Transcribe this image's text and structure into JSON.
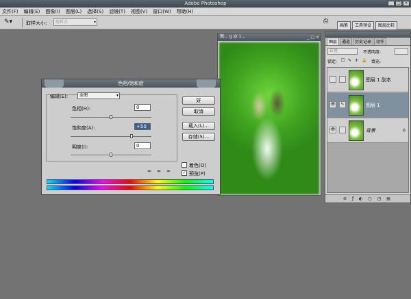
{
  "app": {
    "title": "Adobe Photoshop"
  },
  "menu": [
    "文件(F)",
    "编辑(E)",
    "图像(I)",
    "图层(L)",
    "选择(S)",
    "滤镜(T)",
    "视图(V)",
    "窗口(W)",
    "帮助(H)"
  ],
  "options": {
    "sample_label": "取样大小:",
    "sample_value": "取样点"
  },
  "palette_tabs": [
    "画笔",
    "工具预设",
    "图层比较"
  ],
  "layers_panel": {
    "tabs": [
      "图层",
      "通道",
      "历史记录",
      "动作"
    ],
    "blend_mode": "正常",
    "opacity_label": "不透明度:",
    "lock_label": "锁定:",
    "fill_label": "填充:",
    "layers": [
      {
        "name": "图层 1 副本",
        "selected": false,
        "locked": false
      },
      {
        "name": "图层 1",
        "selected": true,
        "locked": false
      },
      {
        "name": "背景",
        "selected": false,
        "locked": true
      }
    ]
  },
  "document": {
    "title": "图… g @ 1…"
  },
  "dialog": {
    "title": "色相/饱和度",
    "edit_label": "编辑(E):",
    "edit_value": "全图",
    "hue_label": "色相(H):",
    "hue_value": "0",
    "saturation_label": "饱和度(A):",
    "saturation_value": "+50",
    "lightness_label": "明度(I):",
    "lightness_value": "0",
    "ok_label": "好",
    "cancel_label": "取消",
    "load_label": "载入(L)...",
    "save_label": "存储(S)...",
    "colorize_label": "着色(O)",
    "colorize_checked": false,
    "preview_label": "预览(P)",
    "preview_checked": true,
    "hue_fraction": 0.5,
    "saturation_fraction": 0.75,
    "lightness_fraction": 0.5
  }
}
